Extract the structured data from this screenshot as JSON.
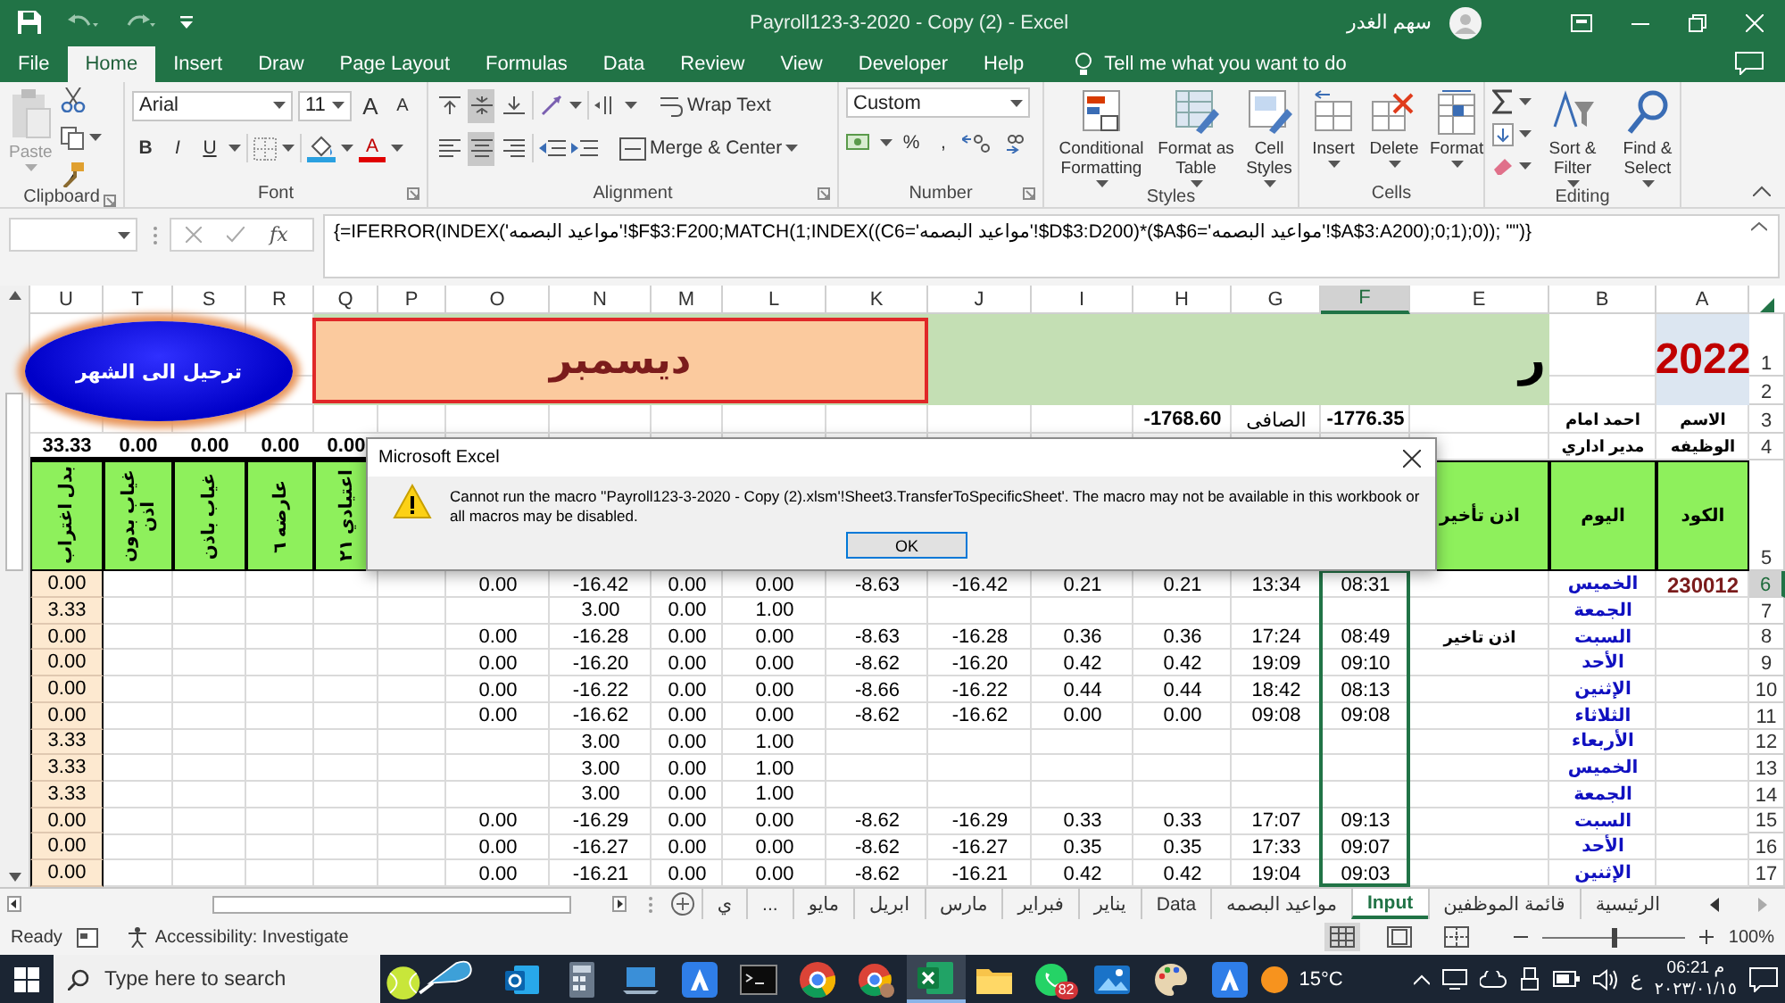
{
  "title_bar": {
    "title": "Payroll123-3-2020 - Copy (2) - Excel",
    "user": "سهم الغدر"
  },
  "ribbon_tabs": [
    {
      "label": "File",
      "selected": false
    },
    {
      "label": "Home",
      "selected": true
    },
    {
      "label": "Insert",
      "selected": false
    },
    {
      "label": "Draw",
      "selected": false
    },
    {
      "label": "Page Layout",
      "selected": false
    },
    {
      "label": "Formulas",
      "selected": false
    },
    {
      "label": "Data",
      "selected": false
    },
    {
      "label": "Review",
      "selected": false
    },
    {
      "label": "View",
      "selected": false
    },
    {
      "label": "Developer",
      "selected": false
    },
    {
      "label": "Help",
      "selected": false
    }
  ],
  "tell_me": "Tell me what you want to do",
  "ribbon": {
    "clipboard": {
      "paste": "Paste",
      "label": "Clipboard"
    },
    "font": {
      "name": "Arial",
      "size": "11",
      "grow": "A",
      "shrink": "A",
      "bold": "B",
      "italic": "I",
      "underline": "U",
      "font_color": "A",
      "label": "Font"
    },
    "alignment": {
      "vertical": [
        {
          "selected": false
        },
        {
          "selected": true
        },
        {
          "selected": false
        }
      ],
      "horizontal": [
        {
          "selected": false
        },
        {
          "selected": true
        },
        {
          "selected": false
        }
      ],
      "wrap": "Wrap Text",
      "merge": "Merge & Center",
      "label": "Alignment"
    },
    "number": {
      "format": "Custom",
      "percent": "%",
      "comma": ",",
      "label": "Number"
    },
    "styles": {
      "buttons": [
        "Conditional Formatting",
        "Format as Table",
        "Cell Styles"
      ],
      "label": "Styles"
    },
    "cells": {
      "buttons": [
        "Insert",
        "Delete",
        "Format"
      ],
      "label": "Cells"
    },
    "editing": {
      "buttons": [
        "Sort & Filter",
        "Find & Select"
      ],
      "label": "Editing"
    }
  },
  "formula_bar": {
    "function_button": "fx",
    "formula": "{=IFERROR(INDEX('مواعيد البصمه'!$F$3:F200;MATCH(1;INDEX((C6='مواعيد البصمه'!$D$3:D200)*($A$6='مواعيد البصمه'!$A$3:A200);0;1);0)); \"\")}"
  },
  "columns": [
    {
      "letter": "U",
      "selected": false
    },
    {
      "letter": "T",
      "selected": false
    },
    {
      "letter": "S",
      "selected": false
    },
    {
      "letter": "R",
      "selected": false
    },
    {
      "letter": "Q",
      "selected": false
    },
    {
      "letter": "P",
      "selected": false
    },
    {
      "letter": "O",
      "selected": false
    },
    {
      "letter": "N",
      "selected": false
    },
    {
      "letter": "M",
      "selected": false
    },
    {
      "letter": "L",
      "selected": false
    },
    {
      "letter": "K",
      "selected": false
    },
    {
      "letter": "J",
      "selected": false
    },
    {
      "letter": "I",
      "selected": false
    },
    {
      "letter": "H",
      "selected": false
    },
    {
      "letter": "G",
      "selected": false
    },
    {
      "letter": "F",
      "selected": true
    },
    {
      "letter": "E",
      "selected": false
    },
    {
      "letter": "B",
      "selected": false
    },
    {
      "letter": "A",
      "selected": false
    }
  ],
  "banner": {
    "year": "2022",
    "title_fragment": "ر",
    "month": "ديسمبر",
    "button": "ترحيل الى الشهر"
  },
  "rows": [
    {
      "number": "1",
      "kind": "banner",
      "selected": false
    },
    {
      "number": "2",
      "kind": "banner",
      "selected": false
    },
    {
      "number": "3",
      "kind": "info",
      "selected": false,
      "cells": [
        "الاسم",
        "احمد امام",
        null,
        "-1776.35",
        "الصافى",
        "-1768.60",
        null,
        null,
        null,
        null,
        null,
        null,
        null,
        null,
        null,
        null,
        null,
        null,
        null
      ]
    },
    {
      "number": "4",
      "kind": "totals",
      "selected": false,
      "cells": [
        "33.33",
        "0.00",
        "0.00",
        "0.00",
        "0.00",
        null,
        null,
        null,
        null,
        null,
        null,
        null,
        null,
        null,
        null,
        null,
        null,
        "مدير اداري",
        "الوظيفه"
      ]
    },
    {
      "number": "5",
      "kind": "header",
      "selected": false,
      "cells": [
        "الكود",
        "اليوم",
        "اذن تأخير",
        null,
        null,
        null,
        null,
        null,
        null,
        null,
        null,
        null,
        null,
        null,
        "اعتيادي ٢١",
        "عارضه ٦",
        "غياب باذن",
        "غياب بدون اذن",
        "بدل اغتراب"
      ]
    },
    {
      "number": "6",
      "kind": "data",
      "selected": true,
      "cells": [
        "0.00",
        null,
        null,
        null,
        null,
        null,
        "0.00",
        "-16.42",
        "0.00",
        "0.00",
        "-8.63",
        "-16.42",
        "0.21",
        "0.21",
        "13:34",
        "08:31",
        null,
        "الخميس",
        "230012"
      ]
    },
    {
      "number": "7",
      "kind": "data",
      "selected": false,
      "cells": [
        "3.33",
        null,
        null,
        null,
        null,
        null,
        null,
        "3.00",
        "0.00",
        "1.00",
        null,
        null,
        null,
        null,
        null,
        null,
        null,
        "الجمعة",
        null
      ]
    },
    {
      "number": "8",
      "kind": "data",
      "selected": false,
      "cells": [
        "0.00",
        null,
        null,
        null,
        null,
        null,
        "0.00",
        "-16.28",
        "0.00",
        "0.00",
        "-8.63",
        "-16.28",
        "0.36",
        "0.36",
        "17:24",
        "08:49",
        "اذن تاخير",
        "السبت",
        null
      ]
    },
    {
      "number": "9",
      "kind": "data",
      "selected": false,
      "cells": [
        "0.00",
        null,
        null,
        null,
        null,
        null,
        "0.00",
        "-16.20",
        "0.00",
        "0.00",
        "-8.62",
        "-16.20",
        "0.42",
        "0.42",
        "19:09",
        "09:10",
        null,
        "الأحد",
        null
      ]
    },
    {
      "number": "10",
      "kind": "data",
      "selected": false,
      "cells": [
        "0.00",
        null,
        null,
        null,
        null,
        null,
        "0.00",
        "-16.22",
        "0.00",
        "0.00",
        "-8.66",
        "-16.22",
        "0.44",
        "0.44",
        "18:42",
        "08:13",
        null,
        "الإثنين",
        null
      ]
    },
    {
      "number": "11",
      "kind": "data",
      "selected": false,
      "cells": [
        "0.00",
        null,
        null,
        null,
        null,
        null,
        "0.00",
        "-16.62",
        "0.00",
        "0.00",
        "-8.62",
        "-16.62",
        "0.00",
        "0.00",
        "09:08",
        "09:08",
        null,
        "الثلاثاء",
        null
      ]
    },
    {
      "number": "12",
      "kind": "data",
      "selected": false,
      "cells": [
        "3.33",
        null,
        null,
        null,
        null,
        null,
        null,
        "3.00",
        "0.00",
        "1.00",
        null,
        null,
        null,
        null,
        null,
        null,
        null,
        "الأربعاء",
        null
      ]
    },
    {
      "number": "13",
      "kind": "data",
      "selected": false,
      "cells": [
        "3.33",
        null,
        null,
        null,
        null,
        null,
        null,
        "3.00",
        "0.00",
        "1.00",
        null,
        null,
        null,
        null,
        null,
        null,
        null,
        "الخميس",
        null
      ]
    },
    {
      "number": "14",
      "kind": "data",
      "selected": false,
      "cells": [
        "3.33",
        null,
        null,
        null,
        null,
        null,
        null,
        "3.00",
        "0.00",
        "1.00",
        null,
        null,
        null,
        null,
        null,
        null,
        null,
        "الجمعة",
        null
      ]
    },
    {
      "number": "15",
      "kind": "data",
      "selected": false,
      "cells": [
        "0.00",
        null,
        null,
        null,
        null,
        null,
        "0.00",
        "-16.29",
        "0.00",
        "0.00",
        "-8.62",
        "-16.29",
        "0.33",
        "0.33",
        "17:07",
        "09:13",
        null,
        "السبت",
        null
      ]
    },
    {
      "number": "16",
      "kind": "data",
      "selected": false,
      "cells": [
        "0.00",
        null,
        null,
        null,
        null,
        null,
        "0.00",
        "-16.27",
        "0.00",
        "0.00",
        "-8.62",
        "-16.27",
        "0.35",
        "0.35",
        "17:33",
        "09:07",
        null,
        "الأحد",
        null
      ]
    },
    {
      "number": "17",
      "kind": "data",
      "selected": false,
      "cells": [
        "0.00",
        null,
        null,
        null,
        null,
        null,
        "0.00",
        "-16.21",
        "0.00",
        "0.00",
        "-8.62",
        "-16.21",
        "0.42",
        "0.42",
        "19:04",
        "09:03",
        null,
        "الإثنين",
        null
      ]
    }
  ],
  "dialog": {
    "title": "Microsoft Excel",
    "message": "Cannot run the macro ''Payroll123-3-2020 - Copy (2).xlsm'!Sheet3.TransferToSpecificSheet'. The macro may not be available in this workbook or all macros may be disabled.",
    "button": "OK"
  },
  "sheet_tabs": [
    {
      "label": "الرئيسية",
      "selected": false
    },
    {
      "label": "قائمة الموظفين",
      "selected": false
    },
    {
      "label": "Input",
      "selected": true
    },
    {
      "label": "مواعيد البصمه",
      "selected": false
    },
    {
      "label": "Data",
      "selected": false
    },
    {
      "label": "يناير",
      "selected": false
    },
    {
      "label": "فبراير",
      "selected": false
    },
    {
      "label": "مارس",
      "selected": false
    },
    {
      "label": "ابريل",
      "selected": false
    },
    {
      "label": "مايو",
      "selected": false
    },
    {
      "label": "...",
      "selected": false
    },
    {
      "label": "ي",
      "selected": false
    }
  ],
  "status_bar": {
    "ready": "Ready",
    "accessibility": "Accessibility: Investigate",
    "views": [
      {
        "selected": true
      },
      {
        "selected": false
      },
      {
        "selected": false
      }
    ],
    "zoom_slider": {
      "level": 0.5
    },
    "zoom": "100%"
  },
  "taskbar": {
    "search_placeholder": "Type here to search",
    "apps": [
      {
        "kind": "outlook",
        "active": false
      },
      {
        "kind": "calculator",
        "active": false
      },
      {
        "kind": "laptop",
        "active": false
      },
      {
        "kind": "a-app",
        "active": false
      },
      {
        "kind": "terminal",
        "active": false
      },
      {
        "kind": "chrome",
        "active": false
      },
      {
        "kind": "chrome-profile",
        "active": false
      },
      {
        "kind": "excel",
        "active": true
      },
      {
        "kind": "folder",
        "active": false
      },
      {
        "kind": "whatsapp",
        "active": false,
        "badge": "82"
      },
      {
        "kind": "photos",
        "active": false
      },
      {
        "kind": "paint",
        "active": false
      },
      {
        "kind": "a-app",
        "active": false
      }
    ],
    "temperature": "15°C",
    "language": "ع",
    "time": "06:21 م",
    "date": "٢٠٢٣/٠١/١٥"
  }
}
